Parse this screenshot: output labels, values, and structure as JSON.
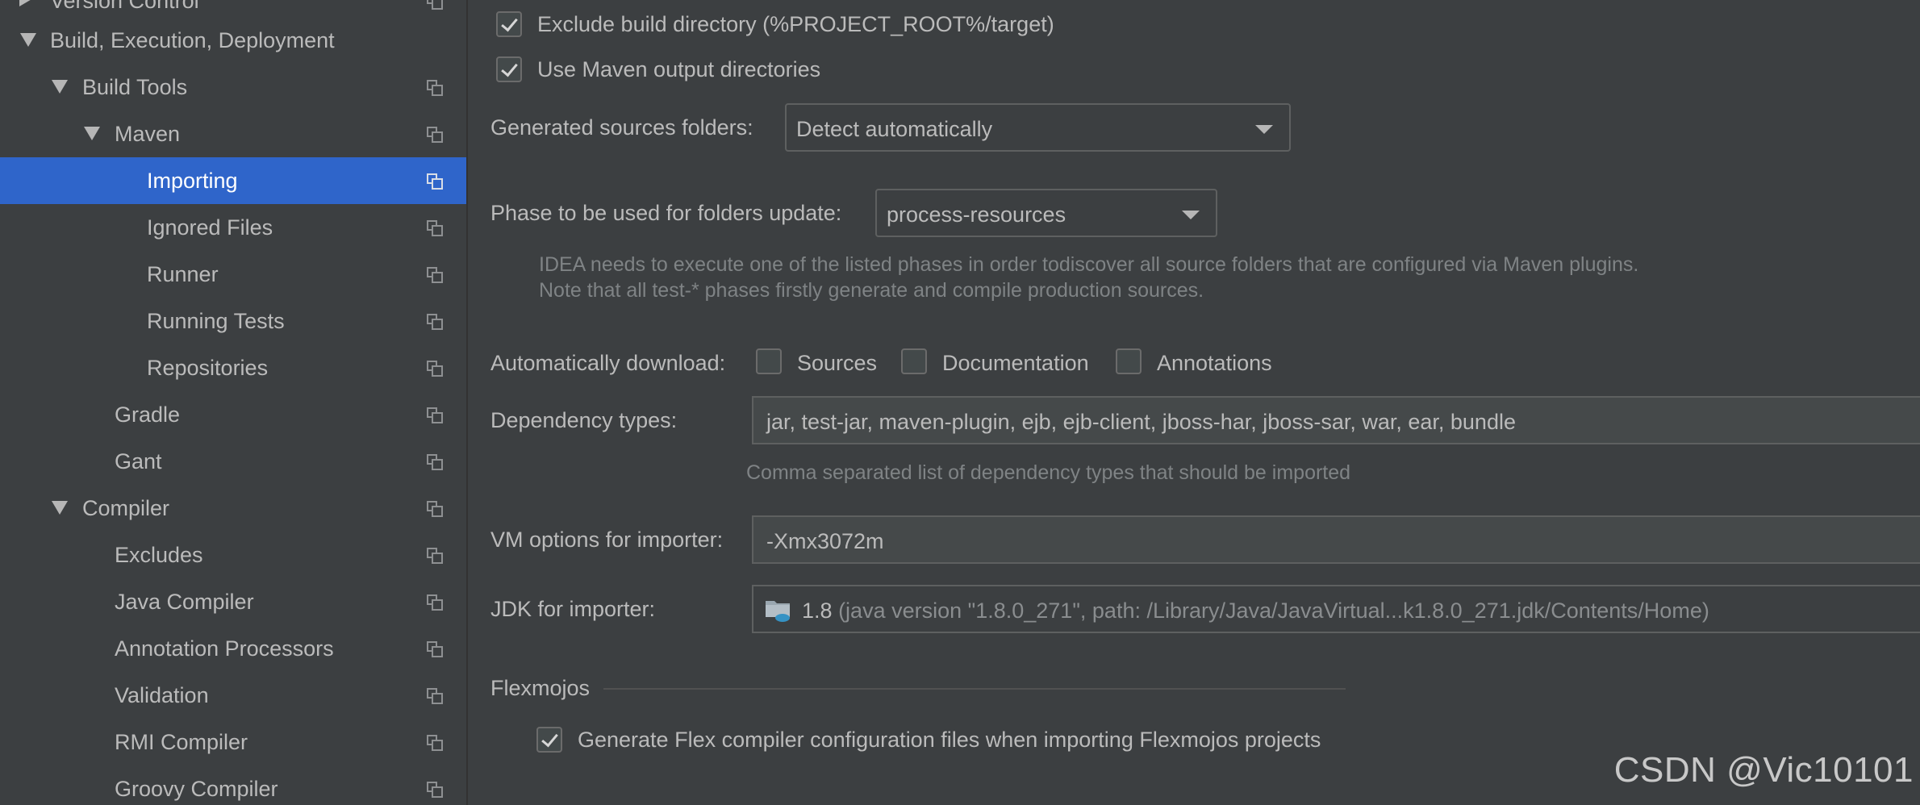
{
  "sidebar": {
    "items": [
      {
        "label": "Version Control"
      },
      {
        "label": "Build, Execution, Deployment"
      },
      {
        "label": "Build Tools"
      },
      {
        "label": "Maven"
      },
      {
        "label": "Importing"
      },
      {
        "label": "Ignored Files"
      },
      {
        "label": "Runner"
      },
      {
        "label": "Running Tests"
      },
      {
        "label": "Repositories"
      },
      {
        "label": "Gradle"
      },
      {
        "label": "Gant"
      },
      {
        "label": "Compiler"
      },
      {
        "label": "Excludes"
      },
      {
        "label": "Java Compiler"
      },
      {
        "label": "Annotation Processors"
      },
      {
        "label": "Validation"
      },
      {
        "label": "RMI Compiler"
      },
      {
        "label": "Groovy Compiler"
      }
    ],
    "selected": "Importing"
  },
  "settings": {
    "exclude_build_dir": {
      "label": "Exclude build directory (%PROJECT_ROOT%/target)",
      "checked": true
    },
    "use_maven_output": {
      "label": "Use Maven output directories",
      "checked": true
    },
    "generated_sources": {
      "label": "Generated sources folders:",
      "value": "Detect automatically"
    },
    "phase": {
      "label": "Phase to be used for folders update:",
      "value": "process-resources",
      "hint_line1": "IDEA needs to execute one of the listed phases in order todiscover all source folders that are configured via Maven plugins.",
      "hint_line2": "Note that all test-* phases firstly generate and compile production sources."
    },
    "auto_download": {
      "label": "Automatically download:",
      "sources": {
        "label": "Sources",
        "checked": false
      },
      "documentation": {
        "label": "Documentation",
        "checked": false
      },
      "annotations": {
        "label": "Annotations",
        "checked": false
      }
    },
    "dependency_types": {
      "label": "Dependency types:",
      "value": "jar, test-jar, maven-plugin, ejb, ejb-client, jboss-har, jboss-sar, war, ear, bundle",
      "hint": "Comma separated list of dependency types that should be imported"
    },
    "vm_options": {
      "label": "VM options for importer:",
      "value": "-Xmx3072m"
    },
    "jdk": {
      "label": "JDK for importer:",
      "version": "1.8",
      "details": "(java version \"1.8.0_271\", path: /Library/Java/JavaVirtual...k1.8.0_271.jdk/Contents/Home)",
      "icon": "folder-icon"
    },
    "flexmojos": {
      "section_title": "Flexmojos",
      "generate_config": {
        "label": "Generate Flex compiler configuration files when importing Flexmojos projects",
        "checked": true
      }
    }
  },
  "watermark": "CSDN @Vic10101",
  "colors": {
    "background": "#3c3f41",
    "selection": "#2f65ca",
    "text": "#bbbbbb",
    "hint": "#7f8385",
    "field_background": "#45494a"
  }
}
